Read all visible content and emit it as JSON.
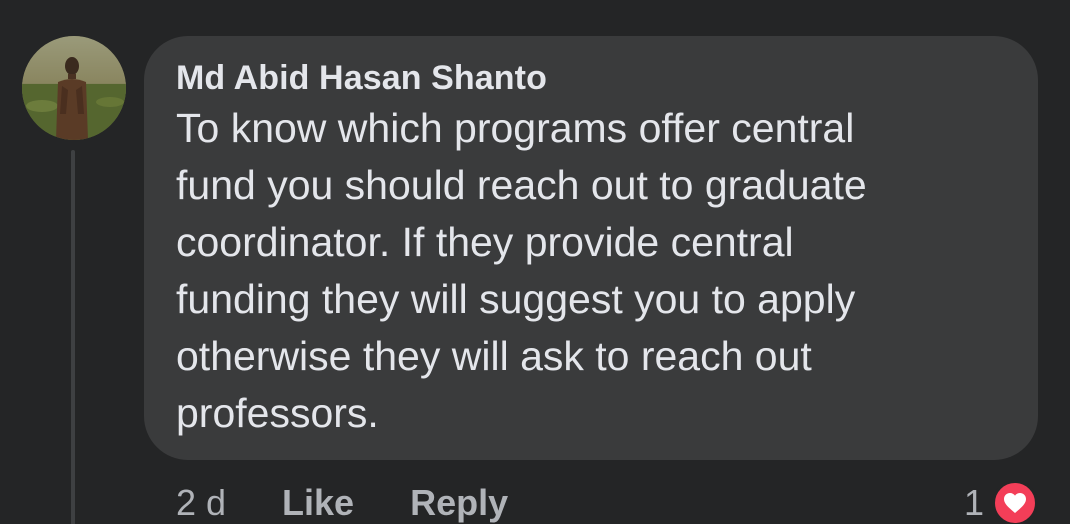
{
  "comment": {
    "author": "Md Abid Hasan Shanto",
    "text": "To know which programs offer central\nfund you should reach out to graduate\ncoordinator. If they provide central\nfunding they will suggest you to apply\notherwise they will ask to reach out\nprofessors."
  },
  "actions": {
    "timestamp": "2 d",
    "like_label": "Like",
    "reply_label": "Reply"
  },
  "reactions": {
    "count": "1",
    "icon": "heart-icon",
    "color": "#f33e58"
  },
  "colors": {
    "background": "#242526",
    "bubble": "#3a3b3c",
    "text": "#e4e6eb",
    "secondary_text": "#b0b3b8"
  }
}
